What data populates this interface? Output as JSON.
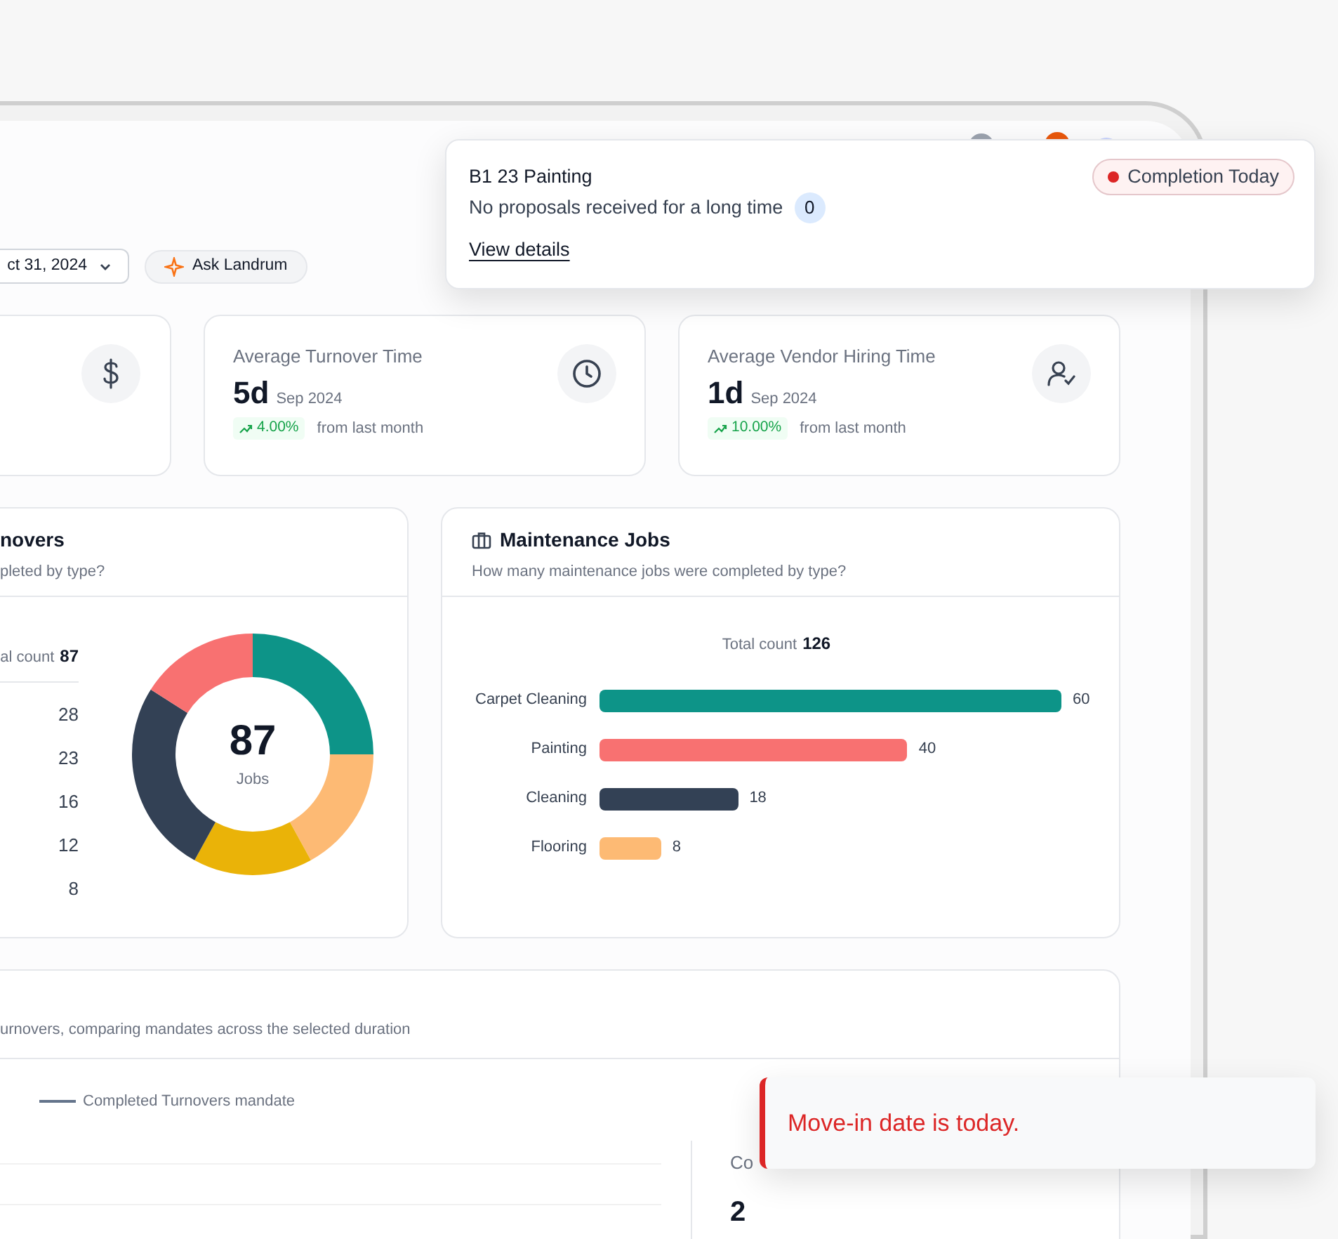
{
  "filters": {
    "date_range": "ct 31, 2024",
    "ask_button": "Ask Landrum"
  },
  "kpis": [
    {
      "title": "Average Turnover Time",
      "value": "5d",
      "period": "Sep 2024",
      "change": "4.00%",
      "note": "from last month"
    },
    {
      "title": "Average Vendor Hiring Time",
      "value": "1d",
      "period": "Sep 2024",
      "change": "10.00%",
      "note": "from last month"
    }
  ],
  "turnovers_card": {
    "title": "novers",
    "subtitle": "pleted by type?",
    "total_label": "al count",
    "total": "87",
    "legend_values": [
      "28",
      "23",
      "16",
      "12",
      "8"
    ],
    "center_value": "87",
    "center_label": "Jobs",
    "chart_data": {
      "type": "donut",
      "series": [
        {
          "values": [
            25,
            17,
            16,
            26,
            16
          ],
          "colors": [
            "#0d9488",
            "#fdba74",
            "#eab308",
            "#334155",
            "#f87171"
          ]
        }
      ]
    }
  },
  "maintenance_card": {
    "title": "Maintenance Jobs",
    "subtitle": "How many maintenance jobs were completed by type?",
    "total_label": "Total count",
    "total": "126",
    "chart_data": {
      "type": "bar",
      "orientation": "horizontal",
      "categories": [
        "Carpet Cleaning",
        "Painting",
        "Cleaning",
        "Flooring"
      ],
      "data_labels": true,
      "series": [
        {
          "values": [
            60,
            40,
            18,
            8
          ],
          "colors": [
            "#0d9488",
            "#f87171",
            "#334155",
            "#fdba74"
          ]
        }
      ]
    }
  },
  "trend_card": {
    "subtitle": "urnovers, comparing mandates across the selected duration",
    "legend": "Completed Turnovers mandate",
    "side_label": "Co",
    "side_value": "2"
  },
  "popup": {
    "title": "B1 23 Painting",
    "status": "Completion Today",
    "message": "No proposals received for a long time",
    "count": "0",
    "link": "View details"
  },
  "toast": {
    "kind": "error",
    "message": "Move-in date is today."
  }
}
